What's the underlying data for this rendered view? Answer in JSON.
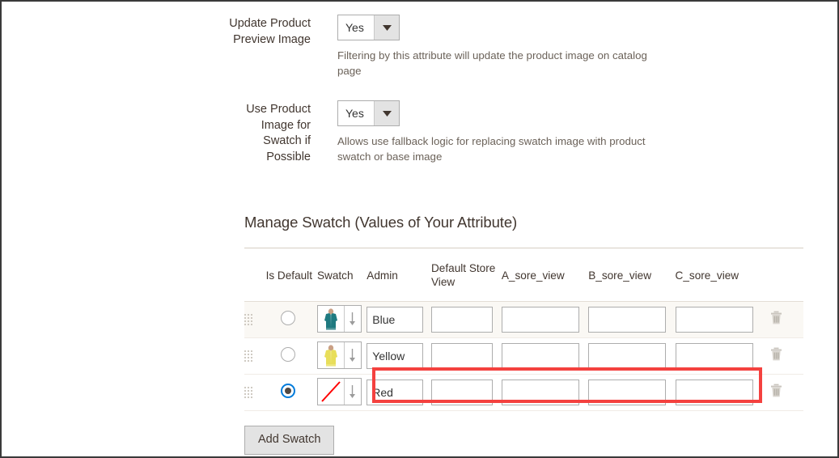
{
  "fields": [
    {
      "label": "Update Product Preview Image",
      "value": "Yes",
      "note": "Filtering by this attribute will update the product image on catalog page"
    },
    {
      "label": "Use Product Image for Swatch if Possible",
      "value": "Yes",
      "note": "Allows use fallback logic for replacing swatch image with product swatch or base image"
    }
  ],
  "swatch_section": {
    "title": "Manage Swatch (Values of Your Attribute)",
    "columns": [
      "",
      "Is Default",
      "Swatch",
      "Admin",
      "Default Store View",
      "A_sore_view",
      "B_sore_view",
      "C_sore_view",
      ""
    ],
    "rows": [
      {
        "is_default": false,
        "swatch_type": "image",
        "swatch_color": "#1f7a80",
        "admin": "Blue",
        "default_store_view": "",
        "a_sore_view": "",
        "b_sore_view": "",
        "c_sore_view": ""
      },
      {
        "is_default": false,
        "swatch_type": "image",
        "swatch_color": "#e8de5a",
        "admin": "Yellow",
        "default_store_view": "",
        "a_sore_view": "",
        "b_sore_view": "",
        "c_sore_view": ""
      },
      {
        "is_default": true,
        "swatch_type": "empty",
        "swatch_color": "#ff0000",
        "admin": "Red",
        "default_store_view": "",
        "a_sore_view": "",
        "b_sore_view": "",
        "c_sore_view": ""
      }
    ],
    "add_button": "Add Swatch"
  },
  "colors": {
    "annotation": "#f4413f",
    "radio_selected": "#007bdb",
    "label_text": "#41362f",
    "note_text": "#6b6259"
  }
}
